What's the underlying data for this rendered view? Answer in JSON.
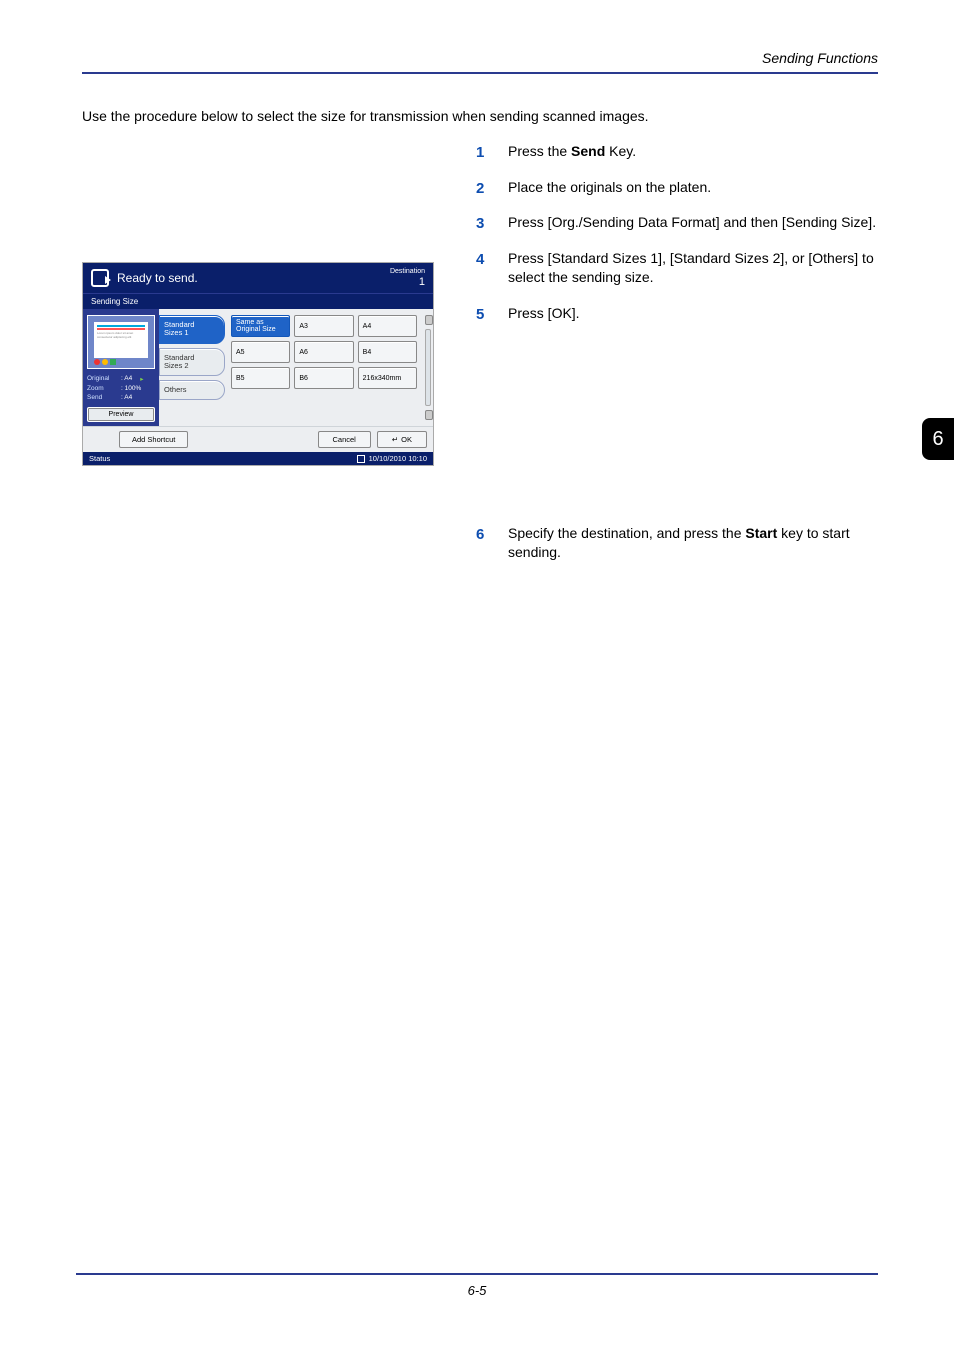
{
  "header": {
    "running_head": "Sending Functions"
  },
  "intro": "Use the procedure below to select the size for transmission when sending scanned images.",
  "steps_a": [
    {
      "pre": "Press the ",
      "bold": "Send",
      "post": " Key."
    },
    {
      "pre": "Place the originals on the platen.",
      "bold": "",
      "post": ""
    },
    {
      "pre": "Press [Org./Sending Data Format] and then [Sending Size].",
      "bold": "",
      "post": ""
    },
    {
      "pre": "Press [Standard Sizes 1], [Standard Sizes 2], or [Others] to select the sending size.",
      "bold": "",
      "post": ""
    },
    {
      "pre": "Press [OK].",
      "bold": "",
      "post": ""
    }
  ],
  "steps_b": [
    {
      "pre": "Specify the destination, and press the ",
      "bold": "Start",
      "post": " key to start sending."
    }
  ],
  "thumb": "6",
  "footer": {
    "page_number": "6-5"
  },
  "device": {
    "title": "Ready to send.",
    "dest_label": "Destination",
    "dest_count": "1",
    "panel_title": "Sending Size",
    "tabs": {
      "std1": "Standard\nSizes 1",
      "std2": "Standard\nSizes 2",
      "others": "Others"
    },
    "grid": {
      "r1": {
        "c1": "Same as\nOriginal Size",
        "c2": "A3",
        "c3": "A4"
      },
      "r2": {
        "c1": "A5",
        "c2": "A6",
        "c3": "B4"
      },
      "r3": {
        "c1": "B5",
        "c2": "B6",
        "c3": "216x340mm"
      }
    },
    "left": {
      "original_lbl": "Original",
      "original_val": ": A4",
      "zoom_lbl": "Zoom",
      "zoom_val": ": 100%",
      "send_lbl": "Send",
      "send_val": ": A4",
      "preview": "Preview"
    },
    "bottom": {
      "add_shortcut": "Add Shortcut",
      "cancel": "Cancel",
      "ok": "OK"
    },
    "status": {
      "label": "Status",
      "datetime": "10/10/2010   10:10"
    }
  }
}
